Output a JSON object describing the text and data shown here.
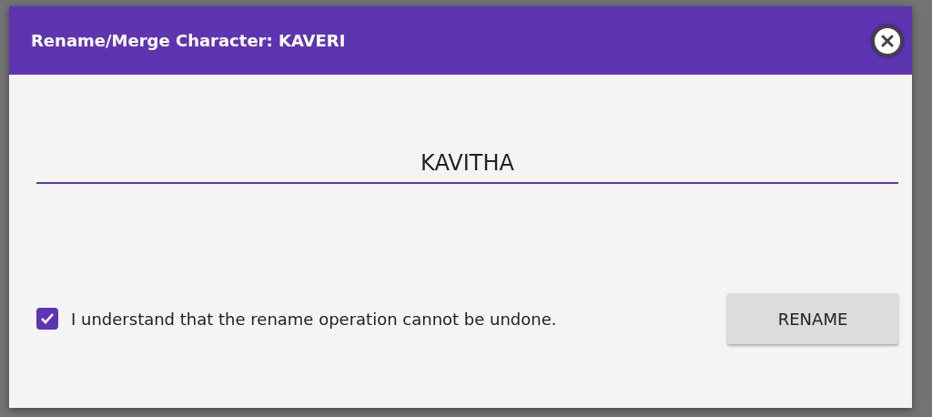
{
  "dialog": {
    "title": "Rename/Merge Character: KAVERI"
  },
  "name_field": {
    "value": "KAVITHA"
  },
  "confirm": {
    "label": "I understand that the rename operation cannot be undone.",
    "checked": true
  },
  "buttons": [
    {
      "label": "RENAME",
      "kind": "primary"
    }
  ]
}
